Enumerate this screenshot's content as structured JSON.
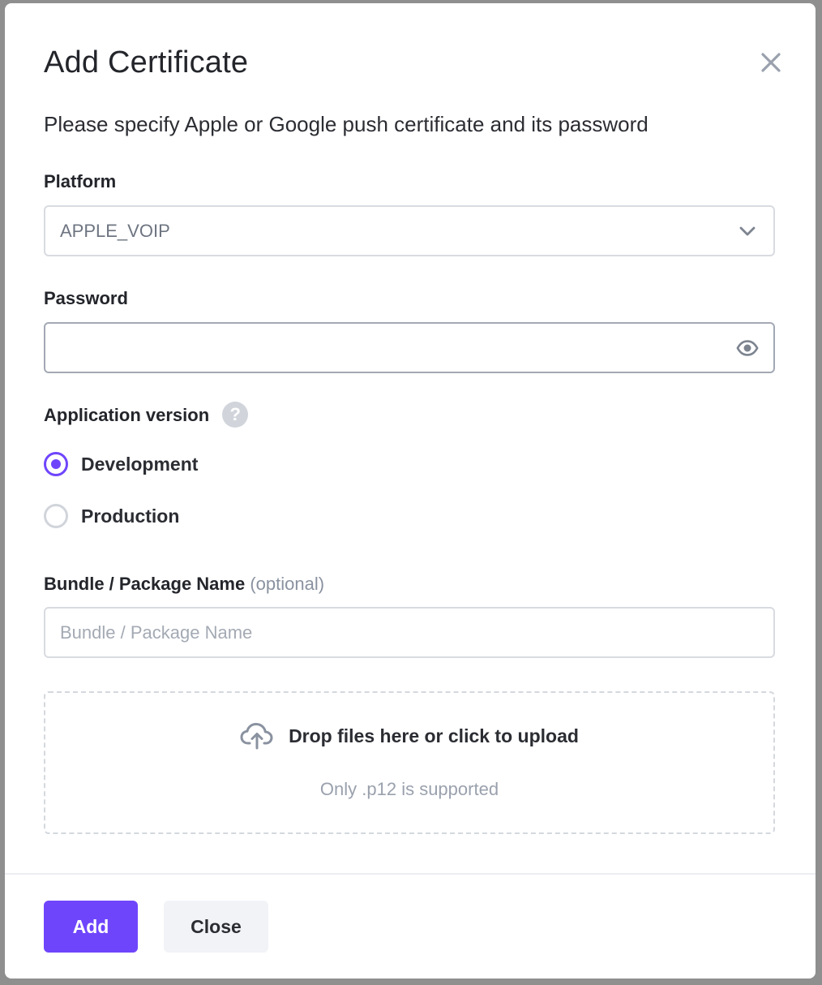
{
  "dialog": {
    "title": "Add Certificate",
    "subtitle": "Please specify Apple or Google push certificate and its password",
    "close_icon": "close-icon"
  },
  "platform": {
    "label": "Platform",
    "selected_value": "APPLE_VOIP",
    "icon": "chevron-down-icon"
  },
  "password": {
    "label": "Password",
    "value": "",
    "icon": "eye-icon"
  },
  "app_version": {
    "label": "Application version",
    "help_icon": "question-circle-icon",
    "help_glyph": "?",
    "options": [
      {
        "label": "Development",
        "checked": true
      },
      {
        "label": "Production",
        "checked": false
      }
    ]
  },
  "bundle": {
    "label": "Bundle / Package Name",
    "optional_label": "(optional)",
    "value": "",
    "placeholder": "Bundle / Package Name"
  },
  "upload": {
    "icon": "cloud-upload-icon",
    "text": "Drop files here or click to upload",
    "hint": "Only .p12 is supported"
  },
  "footer": {
    "add_label": "Add",
    "close_label": "Close"
  },
  "colors": {
    "accent": "#6f45fc",
    "secondary_button_bg": "#f2f3f7",
    "backdrop": "#8f8f8f"
  }
}
